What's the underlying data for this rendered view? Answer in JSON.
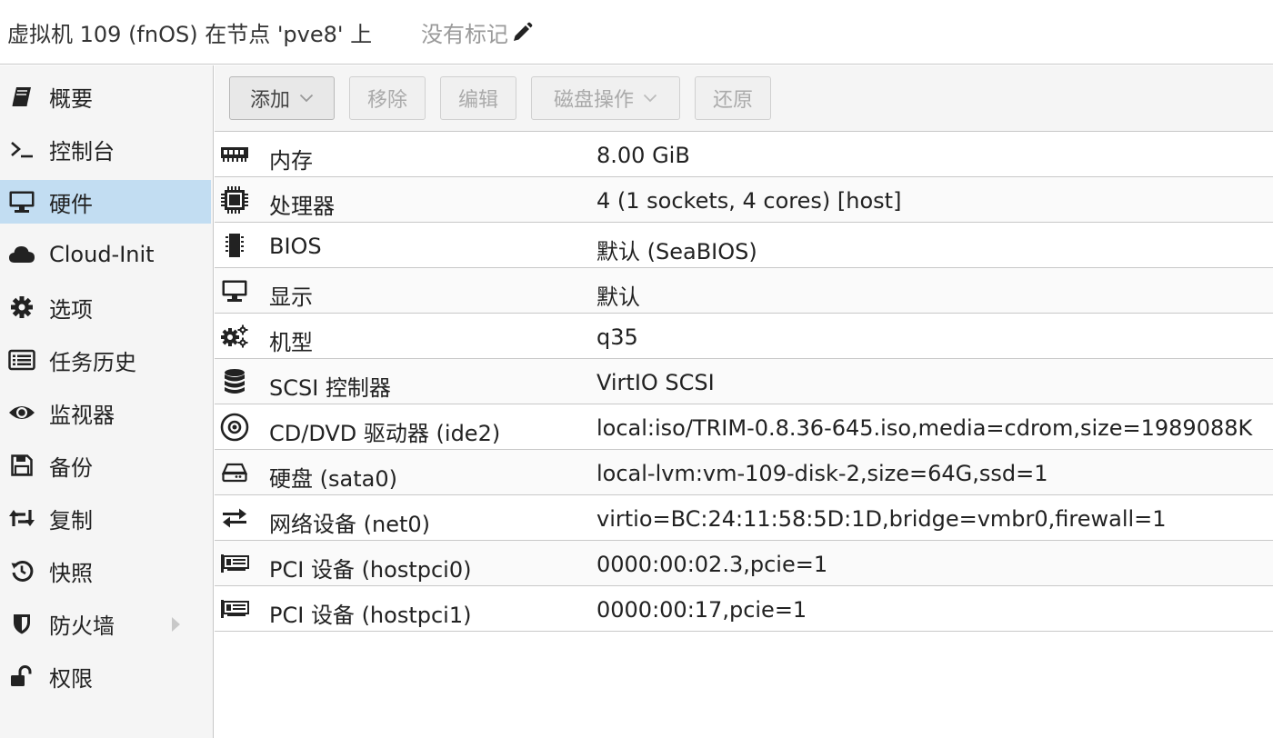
{
  "header": {
    "title": "虚拟机 109 (fnOS) 在节点 'pve8' 上",
    "tags": "没有标记"
  },
  "sidebar": {
    "items": [
      {
        "label": "概要",
        "icon": "book-icon"
      },
      {
        "label": "控制台",
        "icon": "terminal-icon"
      },
      {
        "label": "硬件",
        "icon": "desktop-icon",
        "active": true
      },
      {
        "label": "Cloud-Init",
        "icon": "cloud-icon"
      },
      {
        "label": "选项",
        "icon": "gear-icon"
      },
      {
        "label": "任务历史",
        "icon": "list-icon"
      },
      {
        "label": "监视器",
        "icon": "eye-icon"
      },
      {
        "label": "备份",
        "icon": "floppy-icon"
      },
      {
        "label": "复制",
        "icon": "retweet-icon"
      },
      {
        "label": "快照",
        "icon": "history-icon"
      },
      {
        "label": "防火墙",
        "icon": "shield-icon",
        "expandable": true
      },
      {
        "label": "权限",
        "icon": "unlock-icon"
      }
    ]
  },
  "toolbar": {
    "add": "添加",
    "remove": "移除",
    "edit": "编辑",
    "disk_action": "磁盘操作",
    "revert": "还原"
  },
  "hardware": {
    "rows": [
      {
        "name": "内存",
        "value": "8.00 GiB",
        "icon": "memory-icon"
      },
      {
        "name": "处理器",
        "value": "4 (1 sockets, 4 cores) [host]",
        "icon": "cpu-icon"
      },
      {
        "name": "BIOS",
        "value": "默认 (SeaBIOS)",
        "icon": "microchip-icon"
      },
      {
        "name": "显示",
        "value": "默认",
        "icon": "display-icon"
      },
      {
        "name": "机型",
        "value": "q35",
        "icon": "cogs-icon"
      },
      {
        "name": "SCSI 控制器",
        "value": "VirtIO SCSI",
        "icon": "database-icon"
      },
      {
        "name": "CD/DVD 驱动器 (ide2)",
        "value": "local:iso/TRIM-0.8.36-645.iso,media=cdrom,size=1989088K",
        "icon": "cdrom-icon"
      },
      {
        "name": "硬盘 (sata0)",
        "value": "local-lvm:vm-109-disk-2,size=64G,ssd=1",
        "icon": "hdd-icon"
      },
      {
        "name": "网络设备 (net0)",
        "value": "virtio=BC:24:11:58:5D:1D,bridge=vmbr0,firewall=1",
        "icon": "exchange-icon"
      },
      {
        "name": "PCI 设备 (hostpci0)",
        "value": "0000:00:02.3,pcie=1",
        "icon": "pci-card-icon"
      },
      {
        "name": "PCI 设备 (hostpci1)",
        "value": "0000:00:17,pcie=1",
        "icon": "pci-card-icon"
      }
    ]
  },
  "colors": {
    "selection": "#c2ddf2",
    "sidebar_bg": "#f5f5f5",
    "border": "#c8c8c8"
  }
}
